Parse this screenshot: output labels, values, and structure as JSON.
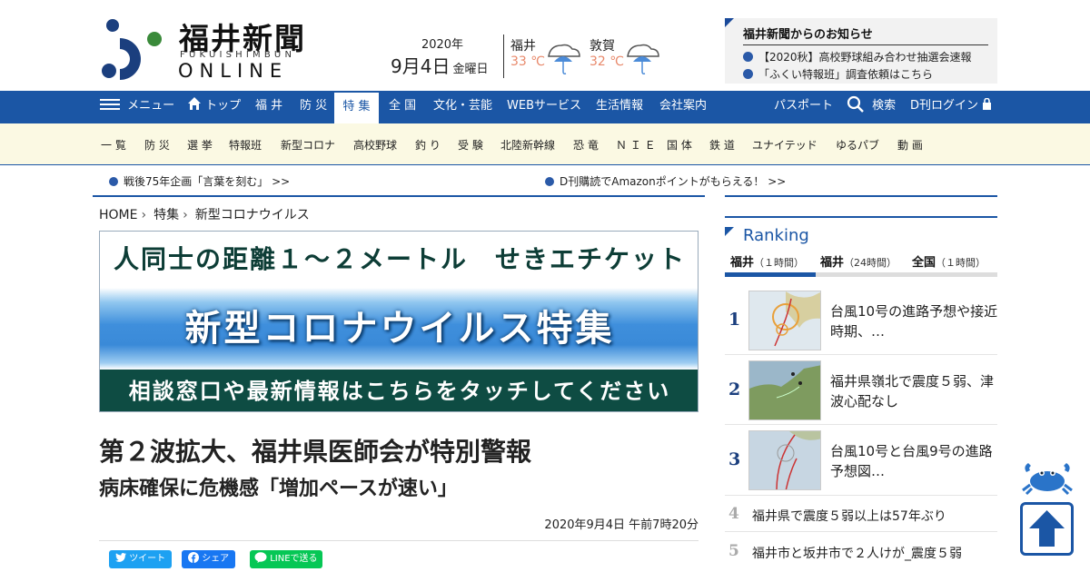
{
  "logo": {
    "title": "福井新聞",
    "sub": "FUKUISHIMBUN",
    "online": "ONLINE"
  },
  "date": {
    "year": "2020年",
    "main": "9月4日",
    "weekday": "金曜日"
  },
  "weather": [
    {
      "city": "福井",
      "temp": "33 ℃",
      "icon": "umbrella-rain-icon"
    },
    {
      "city": "敦賀",
      "temp": "32 ℃",
      "icon": "umbrella-rain-icon"
    }
  ],
  "notice": {
    "title": "福井新聞からのお知らせ",
    "items": [
      "【2020秋】高校野球組み合わせ抽選会速報",
      "「ふくい特報班」調査依頼はこちら"
    ]
  },
  "nav": {
    "menu": "メニュー",
    "items": [
      "トップ",
      "福 井",
      "防 災",
      "特 集",
      "全 国",
      "文化・芸能",
      "WEBサービス",
      "生活情報",
      "会社案内"
    ],
    "active": "特 集",
    "right": [
      "パスポート",
      "検索",
      "D刊ログイン"
    ]
  },
  "subnav": [
    "一 覧",
    "防 災",
    "選 挙",
    "特報班",
    "新型コロナ",
    "高校野球",
    "釣 り",
    "受 験",
    "北陸新幹線",
    "恐 竜",
    "Ｎ Ｉ Ｅ",
    "国 体",
    "鉄 道",
    "ユナイテッド",
    "ゆるパブ",
    "動 画"
  ],
  "ticker": [
    "戦後75年企画「言葉を刻む」 >>",
    "D刊購読でAmazonポイントがもらえる！ >>"
  ],
  "breadcrumb": [
    "HOME",
    "特集",
    "新型コロナウイルス"
  ],
  "banner": {
    "top": "人同士の距離１～２メートル　せきエチケット",
    "mid": "新型コロナウイルス特集",
    "bottom": "相談窓口や最新情報はこちらをタッチしてください"
  },
  "article": {
    "headline": "第２波拡大、福井県医師会が特別警報",
    "subhead": "病床確保に危機感「増加ペースが速い」",
    "date": "2020年9月4日 午前7時20分"
  },
  "share": {
    "twitter": "ツイート",
    "facebook": "シェア",
    "line": "LINEで送る"
  },
  "ranking": {
    "title": "Ranking",
    "tabs": [
      {
        "name": "福井",
        "period": "（１時間）"
      },
      {
        "name": "福井",
        "period": "（24時間）"
      },
      {
        "name": "全国",
        "period": "（１時間）"
      }
    ],
    "items": [
      {
        "rank": "1",
        "text": "台風10号の進路予想や接近時期、…"
      },
      {
        "rank": "2",
        "text": "福井県嶺北で震度５弱、津波心配なし"
      },
      {
        "rank": "3",
        "text": "台風10号と台風9号の進路予想図…"
      },
      {
        "rank": "4",
        "text": "福井県で震度５弱以上は57年ぶり"
      },
      {
        "rank": "5",
        "text": "福井市と坂井市で２人けが_震度５弱"
      }
    ]
  },
  "colors": {
    "brand": "#1b56a5",
    "temp": "#e8896b",
    "banner_green": "#0e4c43"
  }
}
